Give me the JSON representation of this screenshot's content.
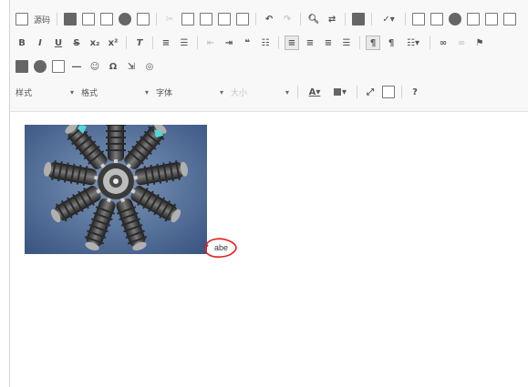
{
  "toolbar": {
    "source_label": "源码",
    "format_combos": [
      {
        "label": "样式"
      },
      {
        "label": "格式"
      },
      {
        "label": "字体"
      },
      {
        "label": "大小"
      }
    ],
    "text_color_icon": "A",
    "help_label": "?"
  },
  "content": {
    "image_alt": "radial engine",
    "inline_text": "abe"
  },
  "colors": {
    "image_background": "#4f6e9a",
    "annotation": "#e02020"
  }
}
